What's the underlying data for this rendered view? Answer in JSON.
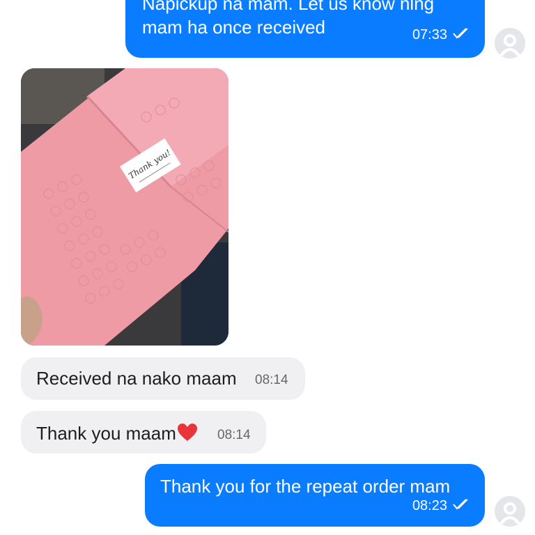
{
  "messages": [
    {
      "direction": "outgoing",
      "lines": [
        "Napickup na mam. Let us know nlng",
        "mam ha once received"
      ],
      "time": "07:33",
      "status": "seen-check-icon"
    },
    {
      "direction": "incoming",
      "type": "photo",
      "photo_caption_text": "Thank you!"
    },
    {
      "direction": "incoming",
      "text": "Received na nako maam",
      "time": "08:14"
    },
    {
      "direction": "incoming",
      "text": "Thank you maam",
      "emoji": "❤️",
      "time": "08:14"
    },
    {
      "direction": "outgoing",
      "text": "Thank you for the repeat order mam",
      "time": "08:23",
      "status": "seen-check-icon"
    }
  ],
  "colors": {
    "outgoing_bubble": "#0a7cff",
    "incoming_bubble": "#f0f0f2",
    "incoming_time": "#65676b",
    "envelope_pink": "#ee9ba6"
  },
  "icons": [
    "seen-check-icon",
    "avatar-placeholder-icon",
    "heart-emoji"
  ]
}
